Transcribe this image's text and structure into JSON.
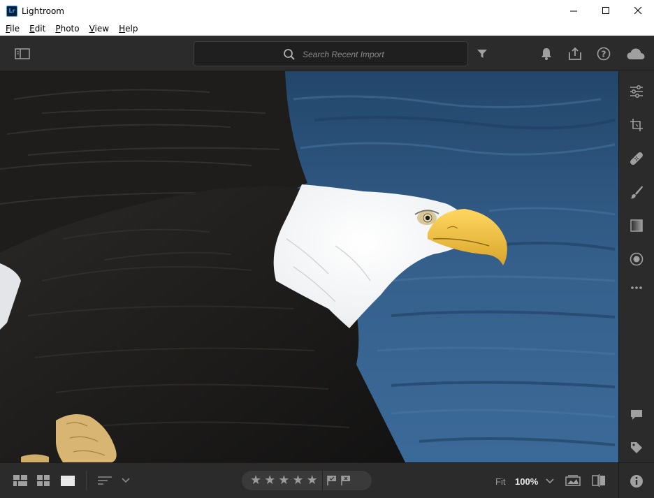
{
  "window": {
    "app_icon_text": "Lr",
    "title": "Lightroom"
  },
  "menu": {
    "items": [
      {
        "u": "F",
        "rest": "ile"
      },
      {
        "u": "E",
        "rest": "dit"
      },
      {
        "u": "P",
        "rest": "hoto"
      },
      {
        "u": "V",
        "rest": "iew"
      },
      {
        "u": "H",
        "rest": "elp"
      }
    ]
  },
  "toolbar": {
    "search_placeholder": "Search Recent Import",
    "icons": [
      "panel-toggle-icon",
      "search-icon",
      "filter-icon",
      "bell-icon",
      "share-icon",
      "help-icon",
      "cloud-icon"
    ]
  },
  "right_panel": {
    "icons": [
      "edit-sliders-icon",
      "crop-icon",
      "healing-icon",
      "brush-icon",
      "linear-gradient-icon",
      "radial-gradient-icon",
      "more-icon",
      "comment-icon",
      "tag-icon",
      "info-icon"
    ]
  },
  "bottom_bar": {
    "stars": [
      "★",
      "★",
      "★",
      "★",
      "★"
    ],
    "fit_label": "Fit",
    "zoom_label": "100%"
  },
  "colors": {
    "accent": "#31a8ff",
    "panel_bg": "#2b2b2b",
    "icon_gray": "#a0a0a0"
  }
}
